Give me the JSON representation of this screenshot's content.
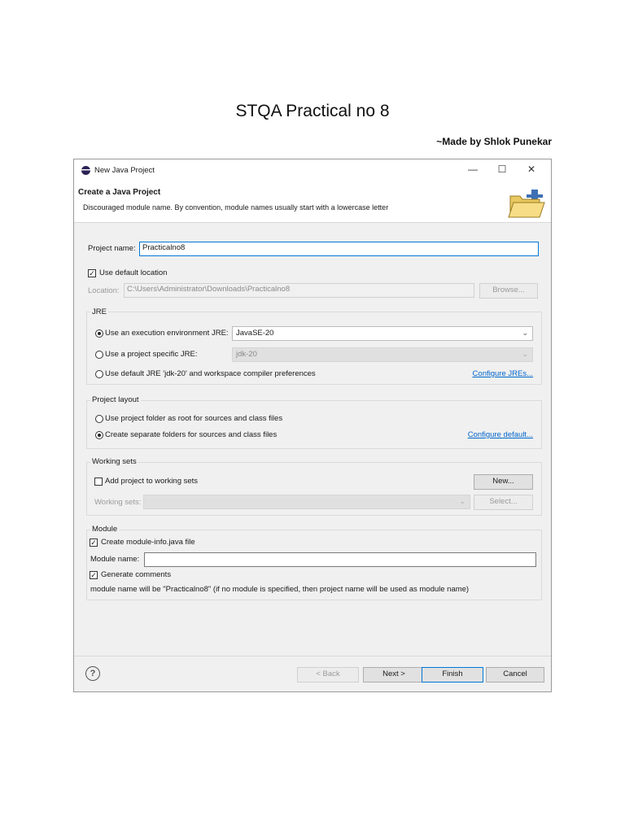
{
  "document": {
    "title": "STQA Practical no 8",
    "author": "~Made by Shlok Punekar"
  },
  "window": {
    "title": "New Java Project",
    "min_glyph": "—",
    "max_glyph": "☐",
    "close_glyph": "✕"
  },
  "header": {
    "title": "Create a Java Project",
    "message": "Discouraged module name. By convention, module names usually start with a lowercase letter"
  },
  "project": {
    "name_label": "Project name:",
    "name_value": "Practicalno8",
    "use_default_label": "Use default location",
    "use_default_checked": true,
    "location_label": "Location:",
    "location_value": "C:\\Users\\Administrator\\Downloads\\Practicalno8",
    "browse_label": "Browse..."
  },
  "jre": {
    "group_label": "JRE",
    "option_execution_env": "Use an execution environment JRE:",
    "execution_env_value": "JavaSE-20",
    "option_project_specific": "Use a project specific JRE:",
    "project_specific_value": "jdk-20",
    "option_default": "Use default JRE 'jdk-20' and workspace compiler preferences",
    "configure_link": "Configure JREs...",
    "selected": "execution_env"
  },
  "layout": {
    "group_label": "Project layout",
    "option_root": "Use project folder as root for sources and class files",
    "option_separate": "Create separate folders for sources and class files",
    "configure_link": "Configure default...",
    "selected": "separate"
  },
  "working_sets": {
    "group_label": "Working sets",
    "add_label": "Add project to working sets",
    "add_checked": false,
    "new_button": "New...",
    "sets_label": "Working sets:",
    "select_button": "Select..."
  },
  "module": {
    "group_label": "Module",
    "create_label": "Create module-info.java file",
    "create_checked": true,
    "name_label": "Module name:",
    "name_value": "",
    "comments_label": "Generate comments",
    "comments_checked": true,
    "note": "module name will be \"Practicalno8\"  (if no module is specified, then project name will be used as module name)"
  },
  "footer": {
    "help_glyph": "?",
    "back_button": "< Back",
    "next_button": "Next >",
    "finish_button": "Finish",
    "cancel_button": "Cancel"
  },
  "colors": {
    "accent": "#0078d7",
    "link": "#0066cc",
    "dialog_bg": "#f0f0f0"
  },
  "icons": {
    "app": "eclipse-icon",
    "banner": "java-project-folder-icon",
    "help": "help-icon"
  }
}
